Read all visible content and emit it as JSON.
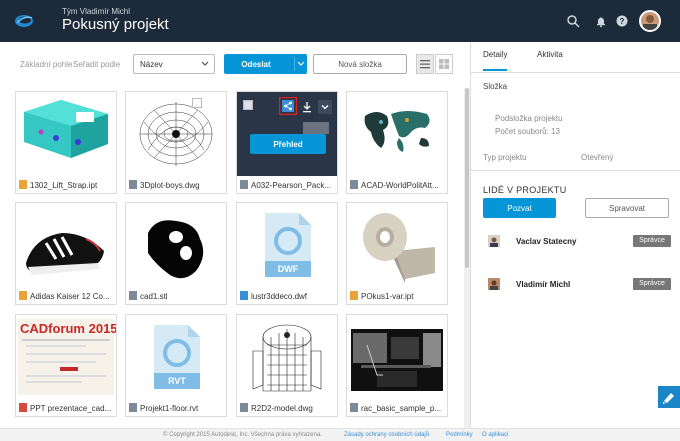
{
  "header": {
    "team": "Tým Vladimír Michl",
    "title": "Pokusný projekt",
    "icons": [
      "search-icon",
      "bell-icon",
      "help-icon"
    ]
  },
  "toolbar": {
    "base_folder_label": "Základní pohle",
    "sort_label": "Seřadit podle",
    "sort_value": "Název",
    "send_label": "Odeslat",
    "new_folder_label": "Nová složka"
  },
  "files": [
    {
      "name": "1302_Lift_Strap.ipt",
      "type_color": "#e8a33b"
    },
    {
      "name": "3Dplot-boys.dwg",
      "type_color": "#7a8a99"
    },
    {
      "name": "A032-Pearson_Pack...",
      "type_color": "#7a8a99",
      "overlay_label": "Přehled"
    },
    {
      "name": "ACAD-WorldPolitAtt...",
      "type_color": "#7a8a99"
    },
    {
      "name": "Adidas Kaiser 12 Co...",
      "type_color": "#e8a33b"
    },
    {
      "name": "cad1.stl",
      "type_color": "#7a8a99"
    },
    {
      "name": "lustr3ddeco.dwf",
      "type_color": "#3a8fd6",
      "badge": "DWF"
    },
    {
      "name": "POkus1-var.ipt",
      "type_color": "#e8a33b"
    },
    {
      "name": "PPT prezentace_cad...",
      "type_color": "#d64a3a",
      "thumb_title": "CADforum 2015"
    },
    {
      "name": "Projekt1-floor.rvt",
      "type_color": "#7a8a99",
      "badge": "RVT"
    },
    {
      "name": "R2D2-model.dwg",
      "type_color": "#7a8a99"
    },
    {
      "name": "rac_basic_sample_p...",
      "type_color": "#7a8a99"
    }
  ],
  "panel": {
    "tabs": [
      "Detaily",
      "Aktivita"
    ],
    "folder_label": "Složka",
    "subfolder": "Podsložka projektu",
    "file_count": "Počet souborů: 13",
    "project_type_label": "Typ projektu",
    "project_type_value": "Otevřený",
    "people_title": "LIDÉ V PROJEKTU",
    "invite_label": "Pozvat",
    "manage_label": "Spravovat",
    "people": [
      {
        "name": "Vaclav Statecny",
        "role": "Správce"
      },
      {
        "name": "Vladimír Michl",
        "role": "Správce"
      }
    ]
  },
  "footer": {
    "copyright": "© Copyright 2015 Autodesk, Inc. Všechna práva vyhrazena.",
    "privacy": "Zásady ochrany osobních údajů",
    "terms": "Podmínky",
    "about": "O aplikaci"
  },
  "colors": {
    "accent": "#0696d7",
    "header": "#1c2a3a"
  }
}
